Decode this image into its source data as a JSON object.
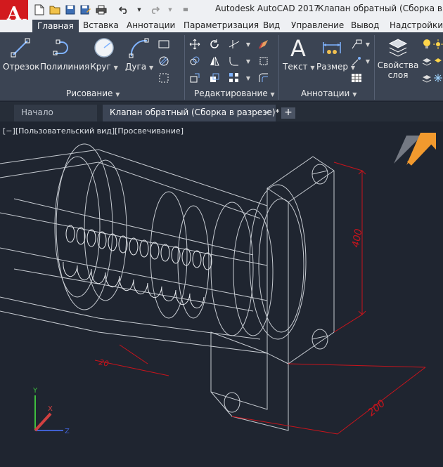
{
  "app": {
    "title": "Autodesk AutoCAD 2017",
    "document_title": "Клапан обратный (Сборка в раз",
    "logo_letter": "A"
  },
  "quick_access": [
    "new-icon",
    "open-icon",
    "save-icon",
    "saveas-icon",
    "print-icon",
    "undo-icon",
    "redo-icon"
  ],
  "ribbon_tabs": [
    "Главная",
    "Вставка",
    "Аннотации",
    "Параметризация",
    "Вид",
    "Управление",
    "Вывод",
    "Надстройки"
  ],
  "ribbon": {
    "draw": {
      "line": "Отрезок",
      "polyline": "Полилиния",
      "circle": "Круг",
      "arc": "Дуга",
      "title": "Рисование"
    },
    "modify": {
      "title": "Редактирование"
    },
    "annotation": {
      "text": "Текст",
      "dimension": "Размер",
      "title": "Аннотации"
    },
    "layers": {
      "properties_line1": "Свойства",
      "properties_line2": "слоя"
    }
  },
  "file_tabs": {
    "home": "Начало",
    "document": "Клапан обратный (Сборка в разрезе)*",
    "close": "×",
    "add": "+"
  },
  "viewport": {
    "control_minus": "[−]",
    "view": "[Пользовательский вид]",
    "style": "[Просвечивание]",
    "dimensions": [
      "400",
      "200",
      "20"
    ],
    "axes": {
      "x": "X",
      "y": "Y",
      "z": "Z"
    }
  },
  "colors": {
    "accent_red": "#d21a1e",
    "ribbon_bg": "#3b4453",
    "viewport_bg": "#1f2530",
    "dimension_red": "#c8141c",
    "viewcube_orange": "#f29a2e"
  }
}
